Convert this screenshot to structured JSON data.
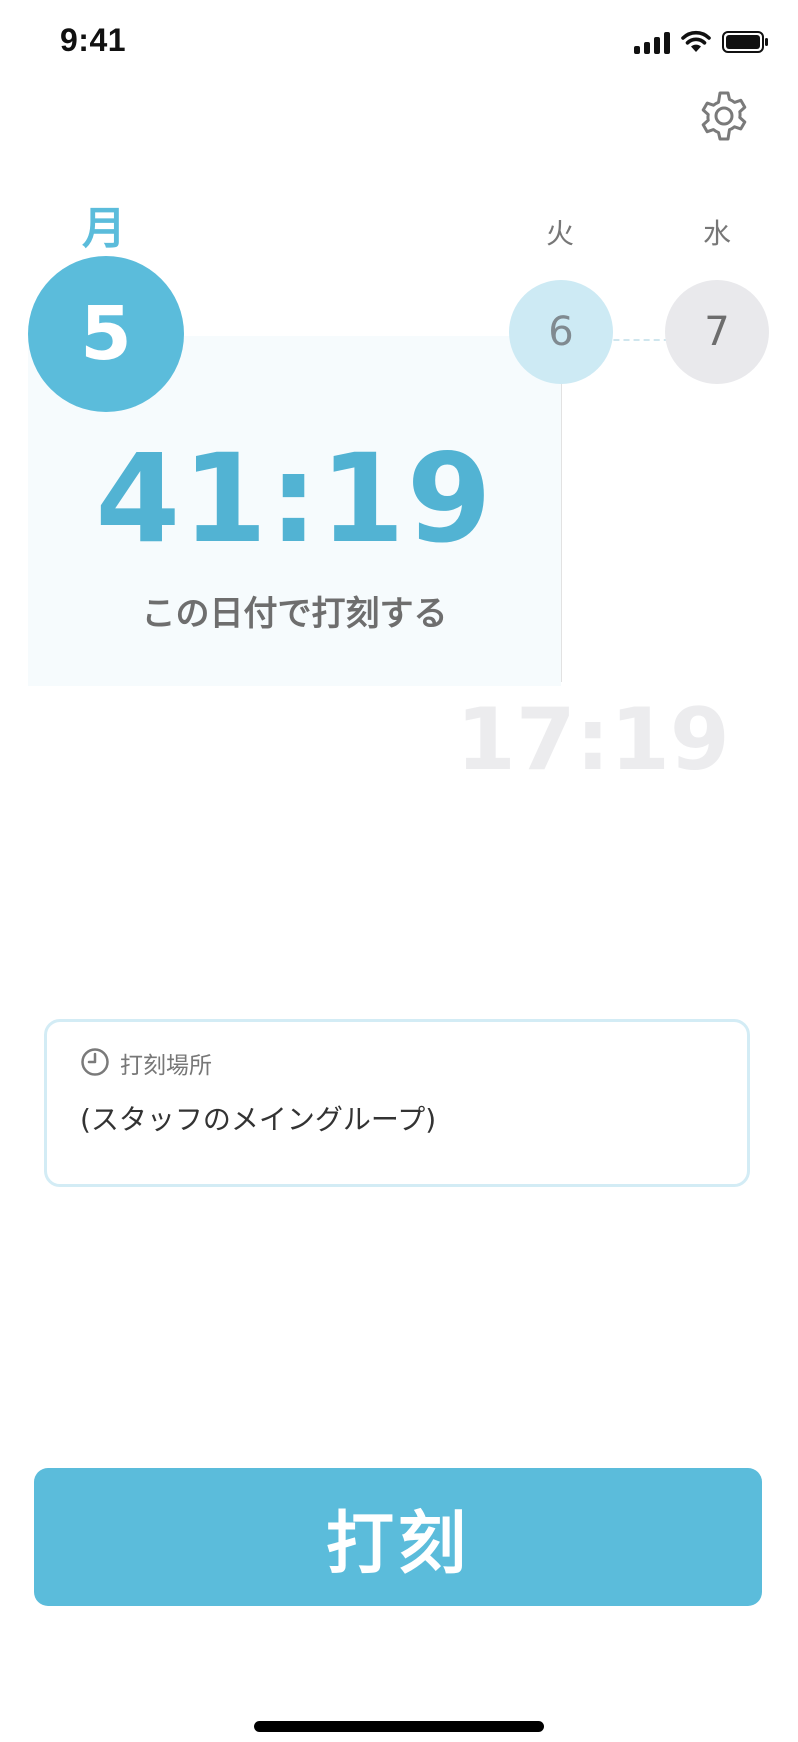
{
  "status_bar": {
    "time": "9:41"
  },
  "days": {
    "active": {
      "weekday": "月",
      "date": "5"
    },
    "next": [
      {
        "weekday": "火",
        "date": "6"
      },
      {
        "weekday": "水",
        "date": "7"
      }
    ]
  },
  "timer": {
    "main_time": "41:19",
    "action_label": "この日付で打刻する",
    "next_time": "17:19"
  },
  "location": {
    "label": "打刻場所",
    "value": "(スタッフのメイングループ)"
  },
  "punch_button": {
    "label": "打刻"
  },
  "icons": {
    "settings": "gear-icon",
    "location": "clock-icon"
  },
  "colors": {
    "accent": "#5bbcdb",
    "accent_light": "#cdeaf4",
    "panel_bg": "#f6fbfd"
  }
}
